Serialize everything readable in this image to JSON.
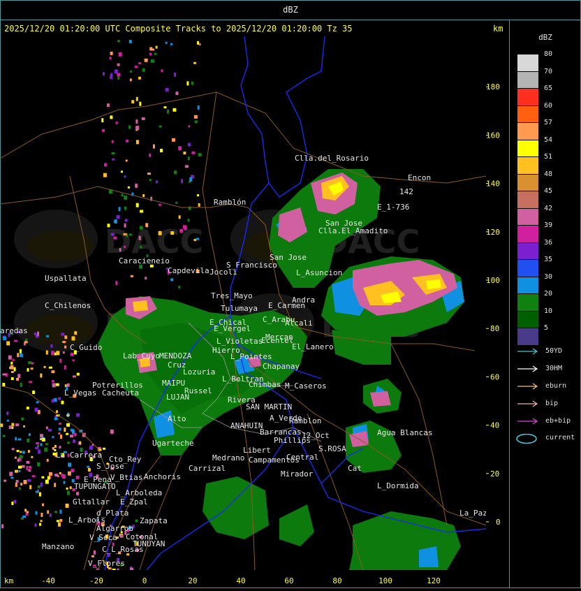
{
  "panel_title": "dBZ",
  "header": "2025/12/20 01:20:00 UTC Composite Tracks to 2025/12/20 01:20:00 Tz 35",
  "km_label": "km",
  "watermark": "DACC",
  "axes": {
    "x_ticks": [
      "-40",
      "-20",
      "0",
      "20",
      "40",
      "60",
      "80",
      "100",
      "120"
    ],
    "y_ticks": [
      "180",
      "160",
      "140",
      "120",
      "100",
      "80",
      "60",
      "40",
      "20",
      "0"
    ]
  },
  "legend": {
    "title": "dBZ",
    "levels": [
      {
        "label": "80",
        "color": "#d8d8d8"
      },
      {
        "label": "70",
        "color": "#b4b4b4"
      },
      {
        "label": "65",
        "color": "#ff3020"
      },
      {
        "label": "60",
        "color": "#ff6010"
      },
      {
        "label": "57",
        "color": "#ff9a50"
      },
      {
        "label": "54",
        "color": "#ffff00"
      },
      {
        "label": "51",
        "color": "#ffc020"
      },
      {
        "label": "48",
        "color": "#d89030"
      },
      {
        "label": "45",
        "color": "#c87060"
      },
      {
        "label": "42",
        "color": "#d060a0"
      },
      {
        "label": "39",
        "color": "#d020a0"
      },
      {
        "label": "36",
        "color": "#7a20d0"
      },
      {
        "label": "35",
        "color": "#2050f0"
      },
      {
        "label": "30",
        "color": "#1090e0"
      },
      {
        "label": "20",
        "color": "#108010"
      },
      {
        "label": "10",
        "color": "#006000"
      },
      {
        "label": "5",
        "color": "#4a3a8a"
      }
    ],
    "tracks": [
      {
        "label": "50YD",
        "color": "#40c8d0"
      },
      {
        "label": "30HM",
        "color": "#ffffff"
      },
      {
        "label": "eburn",
        "color": "#f0c080"
      },
      {
        "label": "bip",
        "color": "#f0b0b0"
      },
      {
        "label": "eb+bip",
        "color": "#e040e0"
      }
    ],
    "current_label": "current",
    "current_color": "#40d0e0"
  },
  "towns": [
    "Clla.del_Rosario",
    "Encon",
    "142",
    "E_1-736",
    "Ramblón",
    "San Jose",
    "Clla.El_Amadito",
    "San Jose",
    "L_Asuncion",
    "Uspallata",
    "Capdevila",
    "S_Francisco",
    "Jocoli",
    "C_Chilenos",
    "Tres_Mayo",
    "Tulumaya",
    "Andra",
    "E_Carmen",
    "Alcali",
    "C_Arabu",
    "E_Chical",
    "E_Vergel",
    "L_Violetas",
    "Mercan",
    "C_Guido",
    "Hierro",
    "Ecentel",
    "El_Lanero",
    "Lab_Cuyo",
    "MENDOZA",
    "Cruz",
    "L_Pointes",
    "Chapanay",
    "Potrerillos",
    "Cacheuta",
    "Lozuria",
    "L_Beltran",
    "Chimbas",
    "M_Caseros",
    "L_Vegas",
    "MAIPU",
    "Russel",
    "Alto",
    "LUJAN",
    "SAN MARTIN",
    "Rivera",
    "A_Verde",
    "Ramblon",
    "Ugarteche",
    "Medrano",
    "ANAHUIN",
    "12_Oct",
    "Barrancas",
    "Phillips",
    "S.ROSA",
    "Agua Blancas",
    "La Carrera",
    "Cto_Rey",
    "S_Jose",
    "Libert",
    "Campamentos",
    "Central",
    "Carrizal",
    "Cat",
    "Anchoris",
    "E_Pena",
    "V_Btias",
    "TUPUNGATO",
    "Mirador",
    "L_Dormida",
    "L_Arboleda",
    "Gltallar",
    "E_Zpal",
    "L_Arbols",
    "d_Plata",
    "Zapata",
    "La_Paz",
    "Algarrob",
    "V_Seca",
    "Cotonal",
    "Manzano",
    "C_L_Rosas",
    "TUNUYAN",
    "V_Flores",
    "aredas",
    "Caracieneio"
  ],
  "colors": {
    "frame": "#4a9aa0",
    "axis_text": "#ffff40",
    "province": "#1a2af0",
    "road": "#8a5a28",
    "dept": "#b0b0b0"
  }
}
